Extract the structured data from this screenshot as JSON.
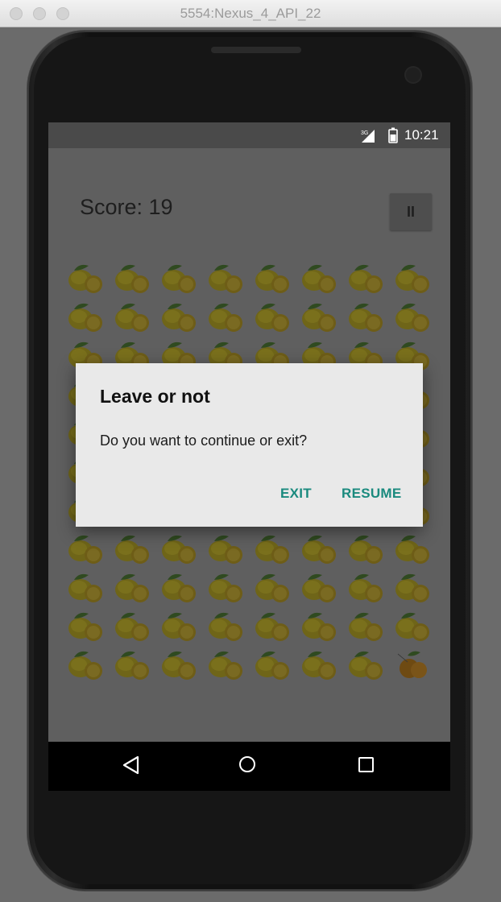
{
  "window": {
    "title": "5554:Nexus_4_API_22"
  },
  "status_bar": {
    "network": "3G",
    "time": "10:21"
  },
  "game": {
    "score_text": "Score: 19",
    "pause_label": "II",
    "grid": {
      "columns": 8,
      "rows": 11,
      "tile": "lemon-tile",
      "selected_tile": "orange-tile"
    }
  },
  "dialog": {
    "title": "Leave or not",
    "message": "Do you want to continue or exit?",
    "exit_label": "EXIT",
    "resume_label": "RESUME"
  },
  "nav_bar": {
    "back": "back-icon",
    "home": "home-icon",
    "recents": "recents-icon"
  },
  "colors": {
    "accent": "#1a8a7e",
    "dim_overlay": "#5f5f5f"
  }
}
